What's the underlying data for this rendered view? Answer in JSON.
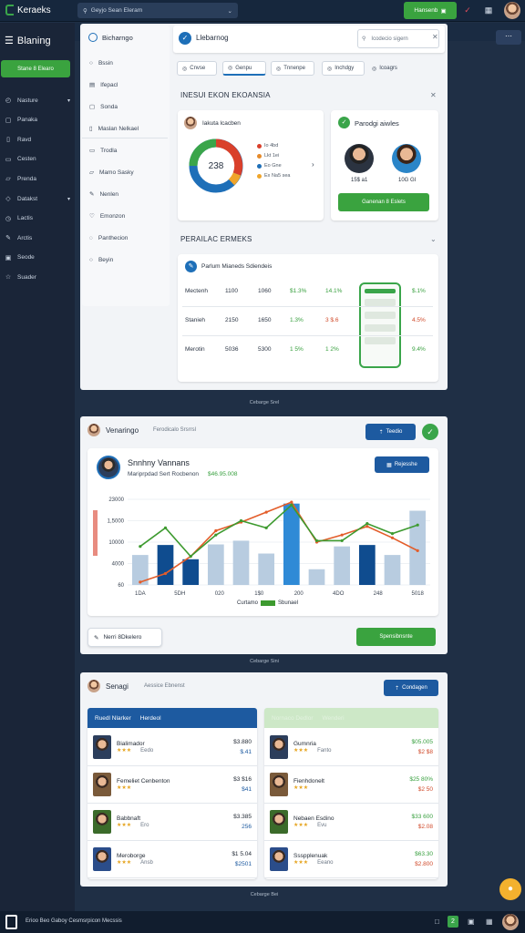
{
  "app": {
    "title": "Keraeks",
    "search": "Geyjo Sean Eleram",
    "top_button": "Hansenb"
  },
  "sidebar": {
    "title": "Blaning",
    "primary_button": "Stane 8 Elearo",
    "items": [
      {
        "label": "Nasture",
        "icon": "gauge-icon",
        "caret": true
      },
      {
        "label": "Panaka",
        "icon": "square-icon",
        "caret": false
      },
      {
        "label": "Ravd",
        "icon": "bookmark-icon",
        "caret": false
      },
      {
        "label": "Cesten",
        "icon": "chat-icon",
        "caret": false
      },
      {
        "label": "Prenda",
        "icon": "folder-icon",
        "caret": false
      },
      {
        "label": "Datakst",
        "icon": "tag-icon",
        "caret": true
      },
      {
        "label": "Lactis",
        "icon": "clock-icon",
        "caret": false
      },
      {
        "label": "Arctis",
        "icon": "pencil-icon",
        "caret": false
      },
      {
        "label": "Seode",
        "icon": "box-icon",
        "caret": false
      },
      {
        "label": "Suader",
        "icon": "star-icon",
        "caret": false
      }
    ]
  },
  "subnav": {
    "title": "Bicharngo",
    "items": [
      "Bssin",
      "Ifepacl",
      "Sonda",
      "Maslan Nelkael",
      "Trodla",
      "Mamo Sasky",
      "Nenlen",
      "Emonzon",
      "Panthecion",
      "Beyin"
    ]
  },
  "main": {
    "header_title": "Llebarnog",
    "search_placeholder": "Icodecio sigern",
    "tabs": [
      "Cnvse",
      "Genpu",
      "Tnnenpe",
      "Inchdgy",
      "Icoagrs"
    ],
    "section1": "INESUI EKON EKOANSIA",
    "donut_card": {
      "name": "Iakuta lcacben",
      "center": "238",
      "legend": [
        {
          "label": "Io 4bd",
          "color": "#d9402b"
        },
        {
          "label": "Lkt 1ei",
          "color": "#e58a2a"
        },
        {
          "label": "Eo Gne",
          "color": "#1e6fb8"
        },
        {
          "label": "Ex Na5 sea",
          "color": "#f0a52b"
        }
      ]
    },
    "people_card": {
      "title": "Parodgi aiwles",
      "p1": "15$ a1",
      "p2": "10G GI",
      "button": "Ganenan 8 Eslets"
    },
    "section2": "PERAILAC ERMEKS",
    "stats_card": {
      "title": "Parlum Mianeds Sdiendeis",
      "rows": [
        {
          "name": "Mectenh",
          "a": "1100",
          "b": "1060",
          "c": "$1.3%",
          "d": "14.1%",
          "e": "$.1%"
        },
        {
          "name": "Stanieh",
          "a": "2150",
          "b": "1650",
          "c": "1.3%",
          "d": "3 $.6",
          "e": "4.5%"
        },
        {
          "name": "Merotin",
          "a": "5036",
          "b": "5300",
          "c": "1 5%",
          "d": "1 2%",
          "e": "9.4%"
        }
      ]
    },
    "caption1": "Cebarge Srel"
  },
  "chart_panel": {
    "header": "Venaringo",
    "header_sub": "Ferodicalo Srsrrsl",
    "header_btn": "Teedio",
    "card_title": "Snnhny Vannans",
    "card_sub": "Mariprpdad Sert Rocbenon",
    "card_amount": "$46.95.008",
    "card_btn": "Rejesshe",
    "footer_left": "Nerri 8Dkelero",
    "footer_right": "Spensibnsnte",
    "caption": "Cebarge Sini",
    "chart_data": {
      "type": "bar",
      "categories": [
        "1DA",
        "",
        "5DH",
        "",
        "020",
        "",
        "1$0",
        "",
        "200",
        "",
        "4DO",
        "",
        "248",
        "",
        "5018"
      ],
      "ylim": [
        0,
        3000
      ],
      "yticks": [
        "60",
        "4000",
        "10000",
        "1,5000",
        "23000"
      ],
      "legend": [
        "Curtamo",
        "Sbunael"
      ],
      "bar_colors": [
        "#b8cce0",
        "#0f4c8f",
        "#0f4c8f",
        "#b8cce0",
        "#b8cce0",
        "#b8cce0",
        "#2f8ad6",
        "#b8cce0",
        "#b8cce0",
        "#0f4c8f",
        "#b8cce0",
        "#b8cce0"
      ],
      "bars": [
        1050,
        1400,
        900,
        1420,
        1550,
        1100,
        2850,
        550,
        1350,
        1400,
        1050,
        2600
      ],
      "series": [
        {
          "name": "Curtamo",
          "color": "#e35d2a",
          "values": [
            100,
            400,
            1000,
            1900,
            2200,
            2550,
            2900,
            1500,
            1750,
            2050,
            1650,
            1200
          ]
        },
        {
          "name": "Sbunael",
          "color": "#3d9a2f",
          "values": [
            1350,
            2000,
            1000,
            1750,
            2250,
            2000,
            2800,
            1550,
            1550,
            2150,
            1800,
            2100
          ]
        }
      ]
    }
  },
  "list_panel": {
    "header": "Senagi",
    "header_sub": "Aessice Ebnenst",
    "header_btn": "Condagen",
    "left_head": [
      "Ruedl Nlarker",
      "Herdeol"
    ],
    "right_head": [
      "Nornaco Dedlor",
      "Wenderi"
    ],
    "left": [
      {
        "name": "Bialimador",
        "stars": "★★★",
        "sub": "Eedo",
        "v1": "$3.880",
        "v2": "$.41"
      },
      {
        "name": "Femeliet Cenbenton",
        "stars": "★★★",
        "sub": "",
        "v1": "$3 $16",
        "v2": "$41"
      },
      {
        "name": "Babbnaft",
        "stars": "★★★",
        "sub": "Ero",
        "v1": "$3.385",
        "v2": "256"
      },
      {
        "name": "Meroborge",
        "stars": "★★★",
        "sub": "Ansb",
        "v1": "$1 5.04",
        "v2": "$2501"
      }
    ],
    "right": [
      {
        "name": "Gumnria",
        "stars": "★★★",
        "sub": "Fanto",
        "v1": "$05.005",
        "v2": "$2 $8"
      },
      {
        "name": "Fienhdonelt",
        "stars": "★★★",
        "sub": "",
        "v1": "$25 80%",
        "v2": "$2 50"
      },
      {
        "name": "Nebaen Esdino",
        "stars": "★★★",
        "sub": "Evu",
        "v1": "$33 600",
        "v2": "$2.08"
      },
      {
        "name": "Ssspplenuak",
        "stars": "★★★",
        "sub": "Eeano",
        "v1": "$63.30",
        "v2": "$2.800"
      }
    ],
    "caption": "Cebarge Bei"
  },
  "footer": {
    "text": "Erioo Beo Gaboy Cesmsrpicon Mecssis"
  }
}
